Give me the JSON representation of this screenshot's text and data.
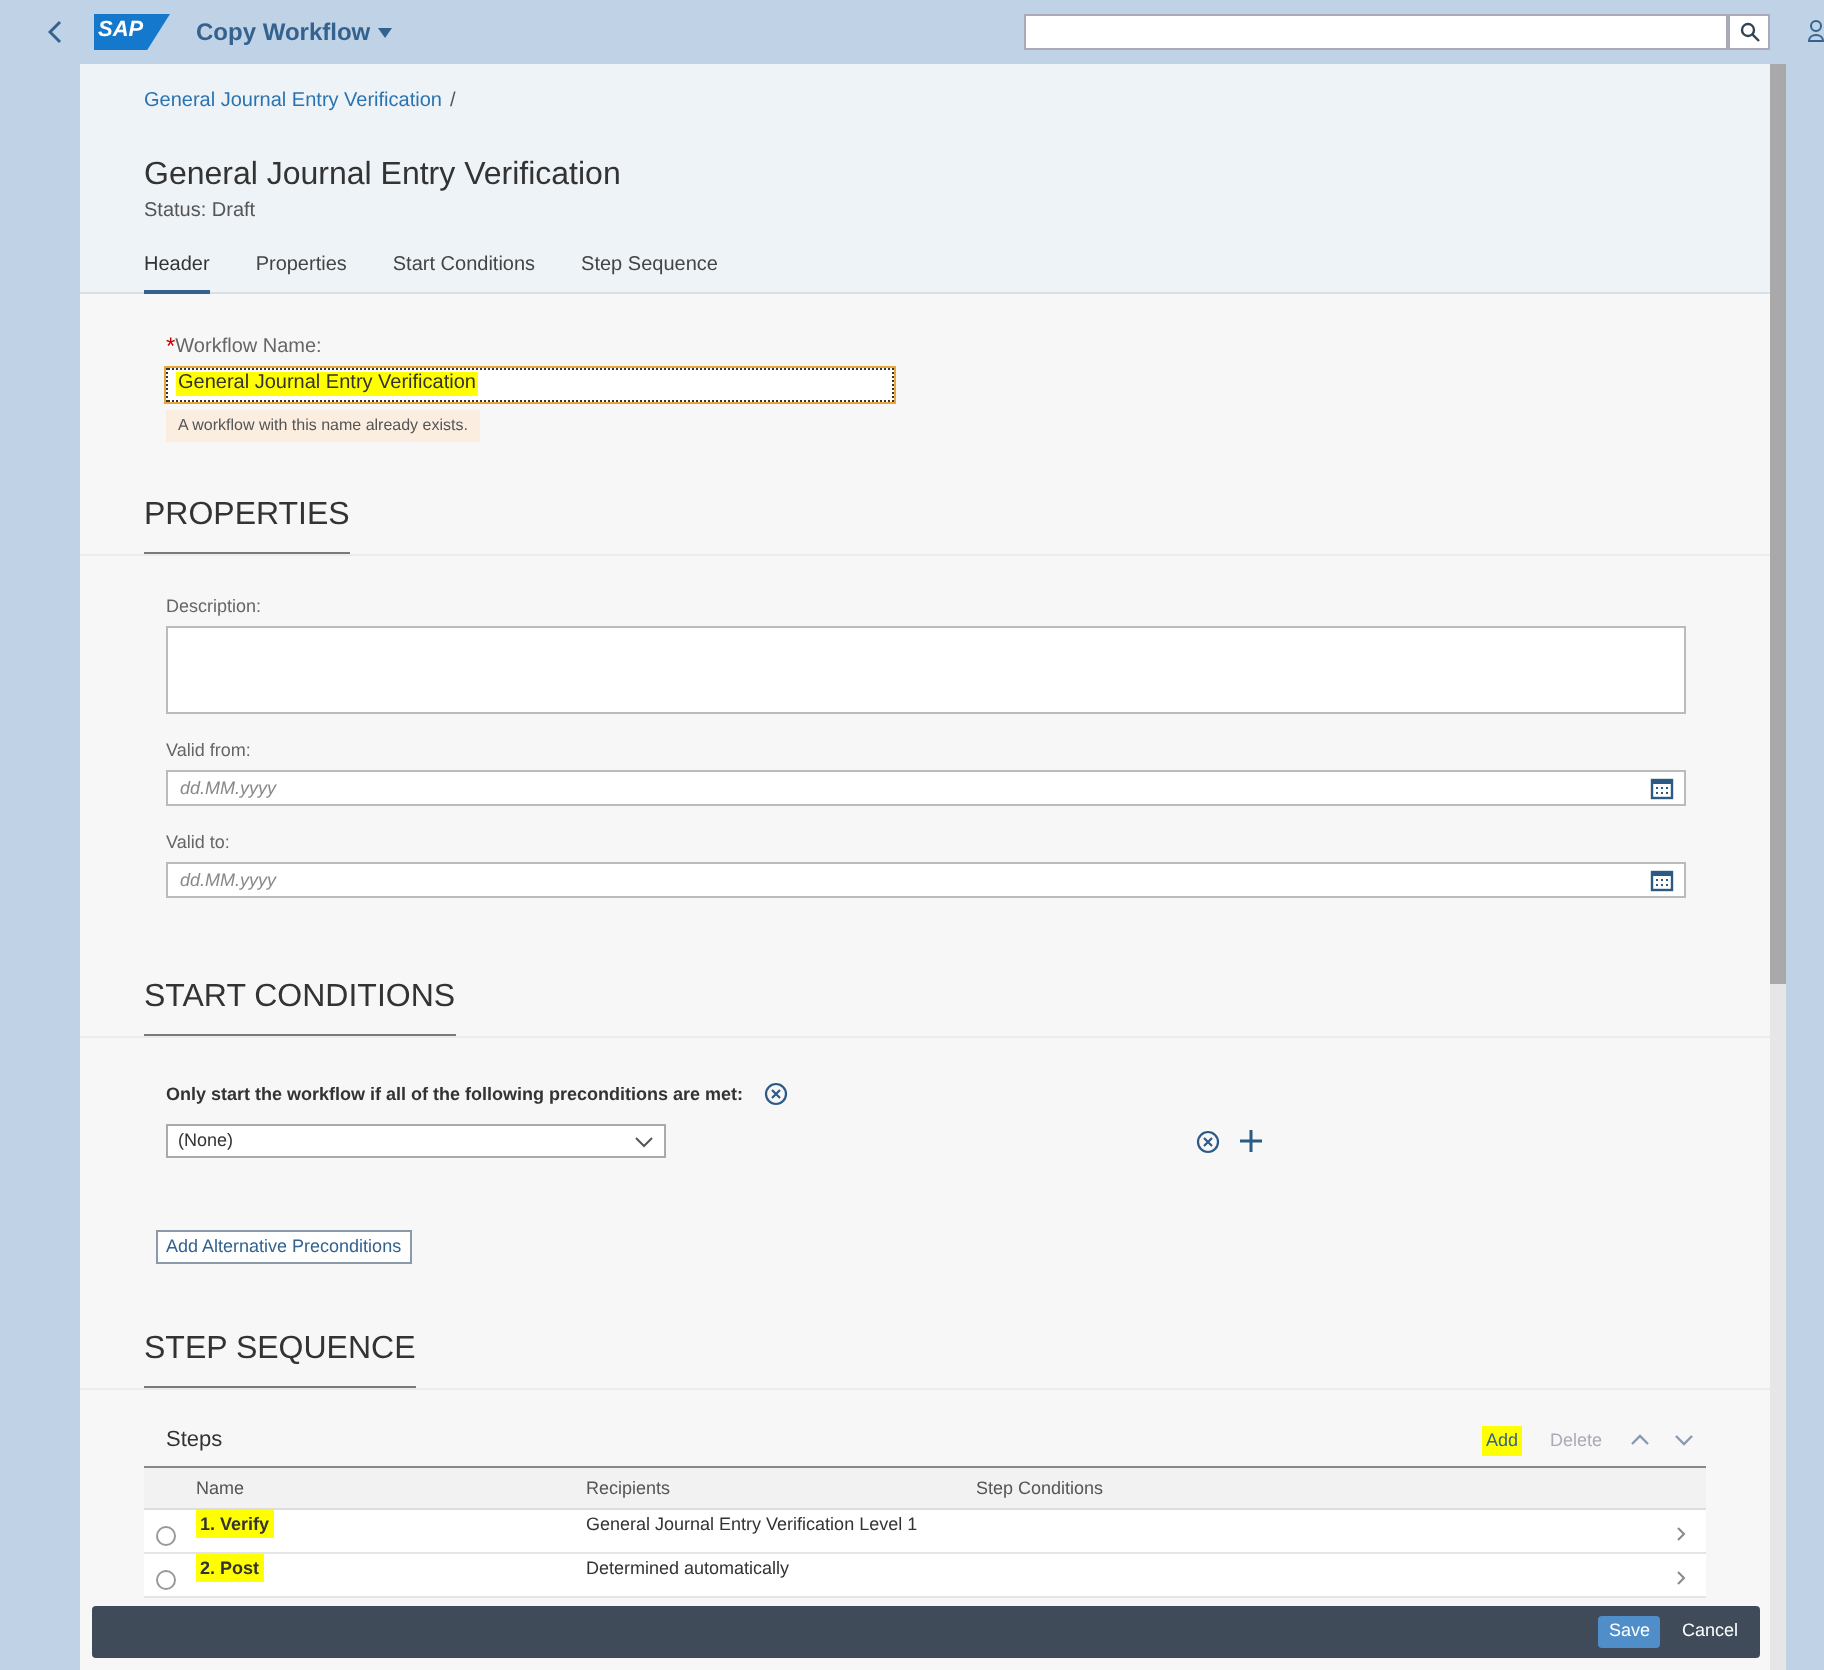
{
  "shell": {
    "logo": "SAP",
    "title": "Copy Workflow"
  },
  "header": {
    "breadcrumb": "General Journal Entry Verification",
    "breadcrumb_separator": "/",
    "title": "General Journal Entry Verification",
    "status": "Status: Draft"
  },
  "tabs": [
    {
      "label": "Header",
      "selected": true
    },
    {
      "label": "Properties",
      "selected": false
    },
    {
      "label": "Start Conditions",
      "selected": false
    },
    {
      "label": "Step Sequence",
      "selected": false
    }
  ],
  "workflow_name": {
    "required_mark": "*",
    "label": "Workflow Name:",
    "value": "General Journal Entry Verification",
    "highlighted": true,
    "message": "A workflow with this name already exists."
  },
  "properties": {
    "heading": "PROPERTIES",
    "description_label": "Description:",
    "valid_from_label": "Valid from:",
    "valid_from_placeholder": "dd.MM.yyyy",
    "valid_to_label": "Valid to:",
    "valid_to_placeholder": "dd.MM.yyyy"
  },
  "start_conditions": {
    "heading": "START CONDITIONS",
    "intro": "Only start the workflow if all of the following preconditions are met:",
    "precondition": "(None)",
    "add_button": "Add Alternative Preconditions"
  },
  "step_sequence": {
    "heading": "STEP SEQUENCE",
    "table_title": "Steps",
    "actions": [
      {
        "label": "Add",
        "disabled": false,
        "highlighted": true
      },
      {
        "label": "Delete",
        "disabled": true,
        "highlighted": false
      }
    ],
    "columns": [
      "Name",
      "Recipients",
      "Step Conditions"
    ],
    "rows": [
      {
        "name": "1. Verify",
        "recipients": "General Journal Entry Verification Level 1",
        "selected": false,
        "highlighted": true
      },
      {
        "name": "2. Post",
        "recipients": "Determined automatically",
        "selected": false,
        "highlighted": true
      }
    ]
  },
  "footer": {
    "buttons": [
      {
        "label": "Save",
        "kind": "primary"
      },
      {
        "label": "Cancel",
        "kind": "plain"
      }
    ]
  }
}
